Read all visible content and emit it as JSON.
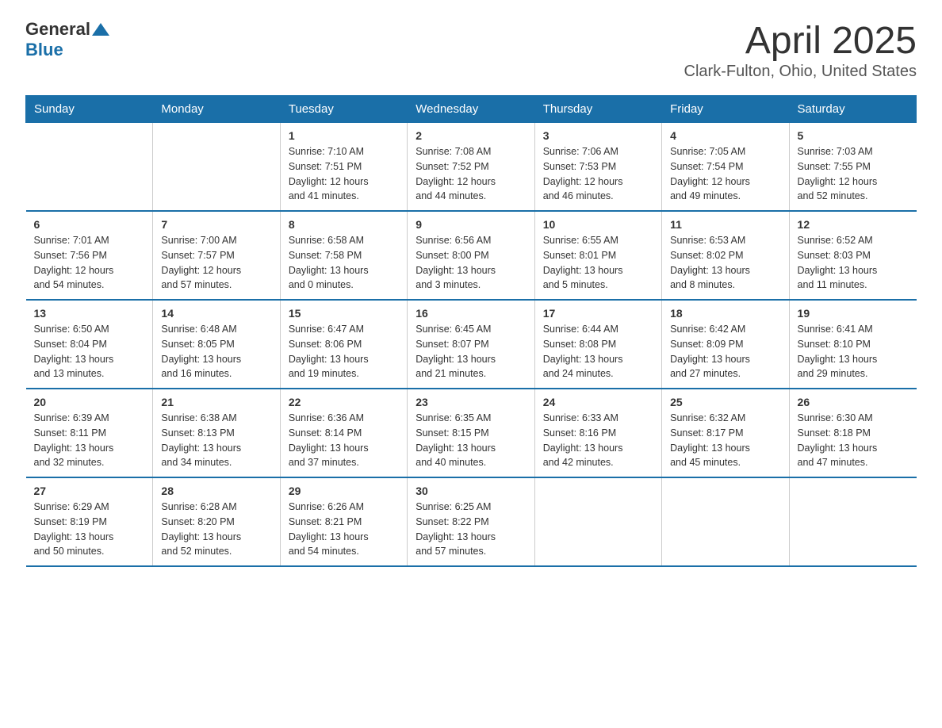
{
  "header": {
    "logo_general": "General",
    "logo_blue": "Blue",
    "title": "April 2025",
    "subtitle": "Clark-Fulton, Ohio, United States"
  },
  "days_of_week": [
    "Sunday",
    "Monday",
    "Tuesday",
    "Wednesday",
    "Thursday",
    "Friday",
    "Saturday"
  ],
  "weeks": [
    [
      {
        "day": "",
        "info": ""
      },
      {
        "day": "",
        "info": ""
      },
      {
        "day": "1",
        "info": "Sunrise: 7:10 AM\nSunset: 7:51 PM\nDaylight: 12 hours\nand 41 minutes."
      },
      {
        "day": "2",
        "info": "Sunrise: 7:08 AM\nSunset: 7:52 PM\nDaylight: 12 hours\nand 44 minutes."
      },
      {
        "day": "3",
        "info": "Sunrise: 7:06 AM\nSunset: 7:53 PM\nDaylight: 12 hours\nand 46 minutes."
      },
      {
        "day": "4",
        "info": "Sunrise: 7:05 AM\nSunset: 7:54 PM\nDaylight: 12 hours\nand 49 minutes."
      },
      {
        "day": "5",
        "info": "Sunrise: 7:03 AM\nSunset: 7:55 PM\nDaylight: 12 hours\nand 52 minutes."
      }
    ],
    [
      {
        "day": "6",
        "info": "Sunrise: 7:01 AM\nSunset: 7:56 PM\nDaylight: 12 hours\nand 54 minutes."
      },
      {
        "day": "7",
        "info": "Sunrise: 7:00 AM\nSunset: 7:57 PM\nDaylight: 12 hours\nand 57 minutes."
      },
      {
        "day": "8",
        "info": "Sunrise: 6:58 AM\nSunset: 7:58 PM\nDaylight: 13 hours\nand 0 minutes."
      },
      {
        "day": "9",
        "info": "Sunrise: 6:56 AM\nSunset: 8:00 PM\nDaylight: 13 hours\nand 3 minutes."
      },
      {
        "day": "10",
        "info": "Sunrise: 6:55 AM\nSunset: 8:01 PM\nDaylight: 13 hours\nand 5 minutes."
      },
      {
        "day": "11",
        "info": "Sunrise: 6:53 AM\nSunset: 8:02 PM\nDaylight: 13 hours\nand 8 minutes."
      },
      {
        "day": "12",
        "info": "Sunrise: 6:52 AM\nSunset: 8:03 PM\nDaylight: 13 hours\nand 11 minutes."
      }
    ],
    [
      {
        "day": "13",
        "info": "Sunrise: 6:50 AM\nSunset: 8:04 PM\nDaylight: 13 hours\nand 13 minutes."
      },
      {
        "day": "14",
        "info": "Sunrise: 6:48 AM\nSunset: 8:05 PM\nDaylight: 13 hours\nand 16 minutes."
      },
      {
        "day": "15",
        "info": "Sunrise: 6:47 AM\nSunset: 8:06 PM\nDaylight: 13 hours\nand 19 minutes."
      },
      {
        "day": "16",
        "info": "Sunrise: 6:45 AM\nSunset: 8:07 PM\nDaylight: 13 hours\nand 21 minutes."
      },
      {
        "day": "17",
        "info": "Sunrise: 6:44 AM\nSunset: 8:08 PM\nDaylight: 13 hours\nand 24 minutes."
      },
      {
        "day": "18",
        "info": "Sunrise: 6:42 AM\nSunset: 8:09 PM\nDaylight: 13 hours\nand 27 minutes."
      },
      {
        "day": "19",
        "info": "Sunrise: 6:41 AM\nSunset: 8:10 PM\nDaylight: 13 hours\nand 29 minutes."
      }
    ],
    [
      {
        "day": "20",
        "info": "Sunrise: 6:39 AM\nSunset: 8:11 PM\nDaylight: 13 hours\nand 32 minutes."
      },
      {
        "day": "21",
        "info": "Sunrise: 6:38 AM\nSunset: 8:13 PM\nDaylight: 13 hours\nand 34 minutes."
      },
      {
        "day": "22",
        "info": "Sunrise: 6:36 AM\nSunset: 8:14 PM\nDaylight: 13 hours\nand 37 minutes."
      },
      {
        "day": "23",
        "info": "Sunrise: 6:35 AM\nSunset: 8:15 PM\nDaylight: 13 hours\nand 40 minutes."
      },
      {
        "day": "24",
        "info": "Sunrise: 6:33 AM\nSunset: 8:16 PM\nDaylight: 13 hours\nand 42 minutes."
      },
      {
        "day": "25",
        "info": "Sunrise: 6:32 AM\nSunset: 8:17 PM\nDaylight: 13 hours\nand 45 minutes."
      },
      {
        "day": "26",
        "info": "Sunrise: 6:30 AM\nSunset: 8:18 PM\nDaylight: 13 hours\nand 47 minutes."
      }
    ],
    [
      {
        "day": "27",
        "info": "Sunrise: 6:29 AM\nSunset: 8:19 PM\nDaylight: 13 hours\nand 50 minutes."
      },
      {
        "day": "28",
        "info": "Sunrise: 6:28 AM\nSunset: 8:20 PM\nDaylight: 13 hours\nand 52 minutes."
      },
      {
        "day": "29",
        "info": "Sunrise: 6:26 AM\nSunset: 8:21 PM\nDaylight: 13 hours\nand 54 minutes."
      },
      {
        "day": "30",
        "info": "Sunrise: 6:25 AM\nSunset: 8:22 PM\nDaylight: 13 hours\nand 57 minutes."
      },
      {
        "day": "",
        "info": ""
      },
      {
        "day": "",
        "info": ""
      },
      {
        "day": "",
        "info": ""
      }
    ]
  ]
}
